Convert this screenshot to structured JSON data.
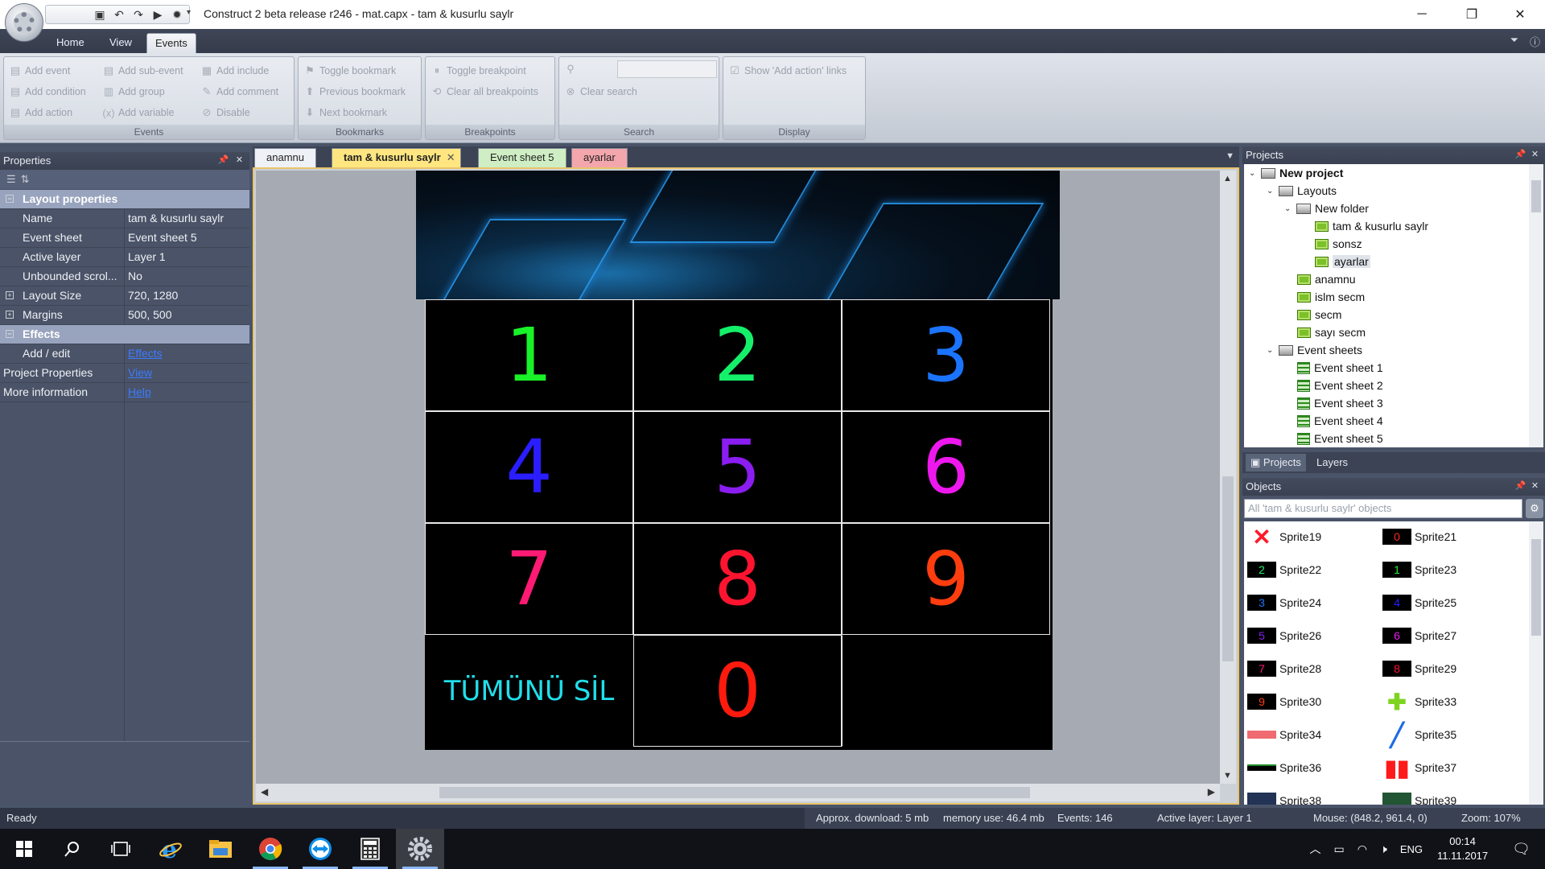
{
  "window": {
    "title": "Construct 2 beta release r246 - mat.capx - tam & kusurlu saylr",
    "controls": [
      "minimize",
      "maximize",
      "close"
    ]
  },
  "ribbon": {
    "tabs": [
      "Home",
      "View",
      "Events"
    ],
    "active_tab": "Events",
    "groups": {
      "events": {
        "label": "Events",
        "buttons": {
          "add_event": "Add event",
          "add_sub_event": "Add sub-event",
          "add_include": "Add include",
          "add_condition": "Add condition",
          "add_group": "Add group",
          "add_comment": "Add comment",
          "add_action": "Add action",
          "add_variable": "Add variable",
          "disable": "Disable"
        }
      },
      "bookmarks": {
        "label": "Bookmarks",
        "buttons": {
          "toggle": "Toggle bookmark",
          "previous": "Previous bookmark",
          "next": "Next bookmark"
        }
      },
      "breakpoints": {
        "label": "Breakpoints",
        "buttons": {
          "toggle": "Toggle breakpoint",
          "clear_all": "Clear all breakpoints"
        }
      },
      "search": {
        "label": "Search",
        "input_value": "",
        "clear": "Clear search"
      },
      "display": {
        "label": "Display",
        "show_add_action": "Show 'Add action' links",
        "show_add_action_checked": true
      }
    }
  },
  "properties": {
    "title": "Properties",
    "layout_category": "Layout properties",
    "rows": [
      {
        "key": "Name",
        "value": "tam & kusurlu saylr"
      },
      {
        "key": "Event sheet",
        "value": "Event sheet 5"
      },
      {
        "key": "Active layer",
        "value": "Layer 1"
      },
      {
        "key": "Unbounded scrol...",
        "value": "No"
      },
      {
        "key": "Layout Size",
        "value": "720, 1280"
      },
      {
        "key": "Margins",
        "value": "500, 500"
      }
    ],
    "effects_category": "Effects",
    "effects_row": {
      "key": "Add / edit",
      "value": "Effects"
    },
    "project_row": {
      "key": "Project Properties",
      "value": "View"
    },
    "info_row": {
      "key": "More information",
      "value": "Help"
    }
  },
  "doc_tabs": [
    {
      "label": "anamnu",
      "color": "#eef1f6"
    },
    {
      "label": "tam & kusurlu saylr",
      "color": "#ffe680",
      "active": true
    },
    {
      "label": "Event sheet 5",
      "color": "#cfeec4"
    },
    {
      "label": "ayarlar",
      "color": "#f4a6ad"
    }
  ],
  "layout": {
    "keys": [
      {
        "label": "1",
        "color": "#19f229"
      },
      {
        "label": "2",
        "color": "#14f06a"
      },
      {
        "label": "3",
        "color": "#1b74ff"
      },
      {
        "label": "4",
        "color": "#2a1dff"
      },
      {
        "label": "5",
        "color": "#8a1df0"
      },
      {
        "label": "6",
        "color": "#ee18ee"
      },
      {
        "label": "7",
        "color": "#ff1a74"
      },
      {
        "label": "8",
        "color": "#ff1430"
      },
      {
        "label": "9",
        "color": "#ff3d0e"
      }
    ],
    "clear_all": "TÜMÜNÜ SİL",
    "zero": {
      "label": "0",
      "color": "#ff1a0e"
    }
  },
  "projects": {
    "title": "Projects",
    "root": "New project",
    "layouts_folder": "Layouts",
    "new_folder": "New folder",
    "folder_layouts": [
      "tam & kusurlu saylr",
      "sonsz",
      "ayarlar"
    ],
    "layouts": [
      "anamnu",
      "islm secm",
      "secm",
      "sayı secm"
    ],
    "event_sheets_folder": "Event sheets",
    "event_sheets": [
      "Event sheet 1",
      "Event sheet 2",
      "Event sheet 3",
      "Event sheet 4",
      "Event sheet 5"
    ],
    "tabs": [
      "Projects",
      "Layers"
    ]
  },
  "objects": {
    "title": "Objects",
    "filter_placeholder": "All 'tam & kusurlu saylr' objects",
    "items": [
      {
        "name": "Sprite19",
        "icon": "red-x",
        "glyph": "✕",
        "color": "#ff1a2a"
      },
      {
        "name": "Sprite21",
        "icon": "digit-0",
        "glyph": "0",
        "color": "#ff2a2a"
      },
      {
        "name": "Sprite22",
        "icon": "digit-2",
        "glyph": "2",
        "color": "#18f06a"
      },
      {
        "name": "Sprite23",
        "icon": "digit-1",
        "glyph": "1",
        "color": "#19f229"
      },
      {
        "name": "Sprite24",
        "icon": "digit-3",
        "glyph": "3",
        "color": "#1b74ff"
      },
      {
        "name": "Sprite25",
        "icon": "digit-4",
        "glyph": "4",
        "color": "#2a1dff"
      },
      {
        "name": "Sprite26",
        "icon": "digit-5",
        "glyph": "5",
        "color": "#8a1df0"
      },
      {
        "name": "Sprite27",
        "icon": "digit-6",
        "glyph": "6",
        "color": "#ee18ee"
      },
      {
        "name": "Sprite28",
        "icon": "digit-7",
        "glyph": "7",
        "color": "#ff1a74"
      },
      {
        "name": "Sprite29",
        "icon": "digit-8",
        "glyph": "8",
        "color": "#ff1430"
      },
      {
        "name": "Sprite30",
        "icon": "digit-9",
        "glyph": "9",
        "color": "#ff3d0e"
      },
      {
        "name": "Sprite33",
        "icon": "green-plus",
        "glyph": "✚",
        "color": "#7ed321"
      },
      {
        "name": "Sprite34",
        "icon": "red-bar",
        "glyph": "",
        "color": "#f06a72"
      },
      {
        "name": "Sprite35",
        "icon": "blue-slash",
        "glyph": "╱",
        "color": "#1e6be6"
      },
      {
        "name": "Sprite36",
        "icon": "green-text-strip",
        "glyph": "",
        "color": "#1c8a2a"
      },
      {
        "name": "Sprite37",
        "icon": "red-shield",
        "glyph": "▮▮",
        "color": "#ff1a1a"
      },
      {
        "name": "Sprite38",
        "icon": "sprite",
        "glyph": "",
        "color": "#223355"
      },
      {
        "name": "Sprite39",
        "icon": "sprite",
        "glyph": "",
        "color": "#225533"
      }
    ]
  },
  "status": {
    "ready": "Ready",
    "download": "Approx. download: 5 mb",
    "memory": "memory use: 46.4 mb",
    "events": "Events: 146",
    "active_layer": "Active layer: Layer 1",
    "mouse": "Mouse: (848.2, 961.4, 0)",
    "zoom": "Zoom: 107%"
  },
  "taskbar": {
    "language": "ENG",
    "time": "00:14",
    "date": "11.11.2017"
  }
}
